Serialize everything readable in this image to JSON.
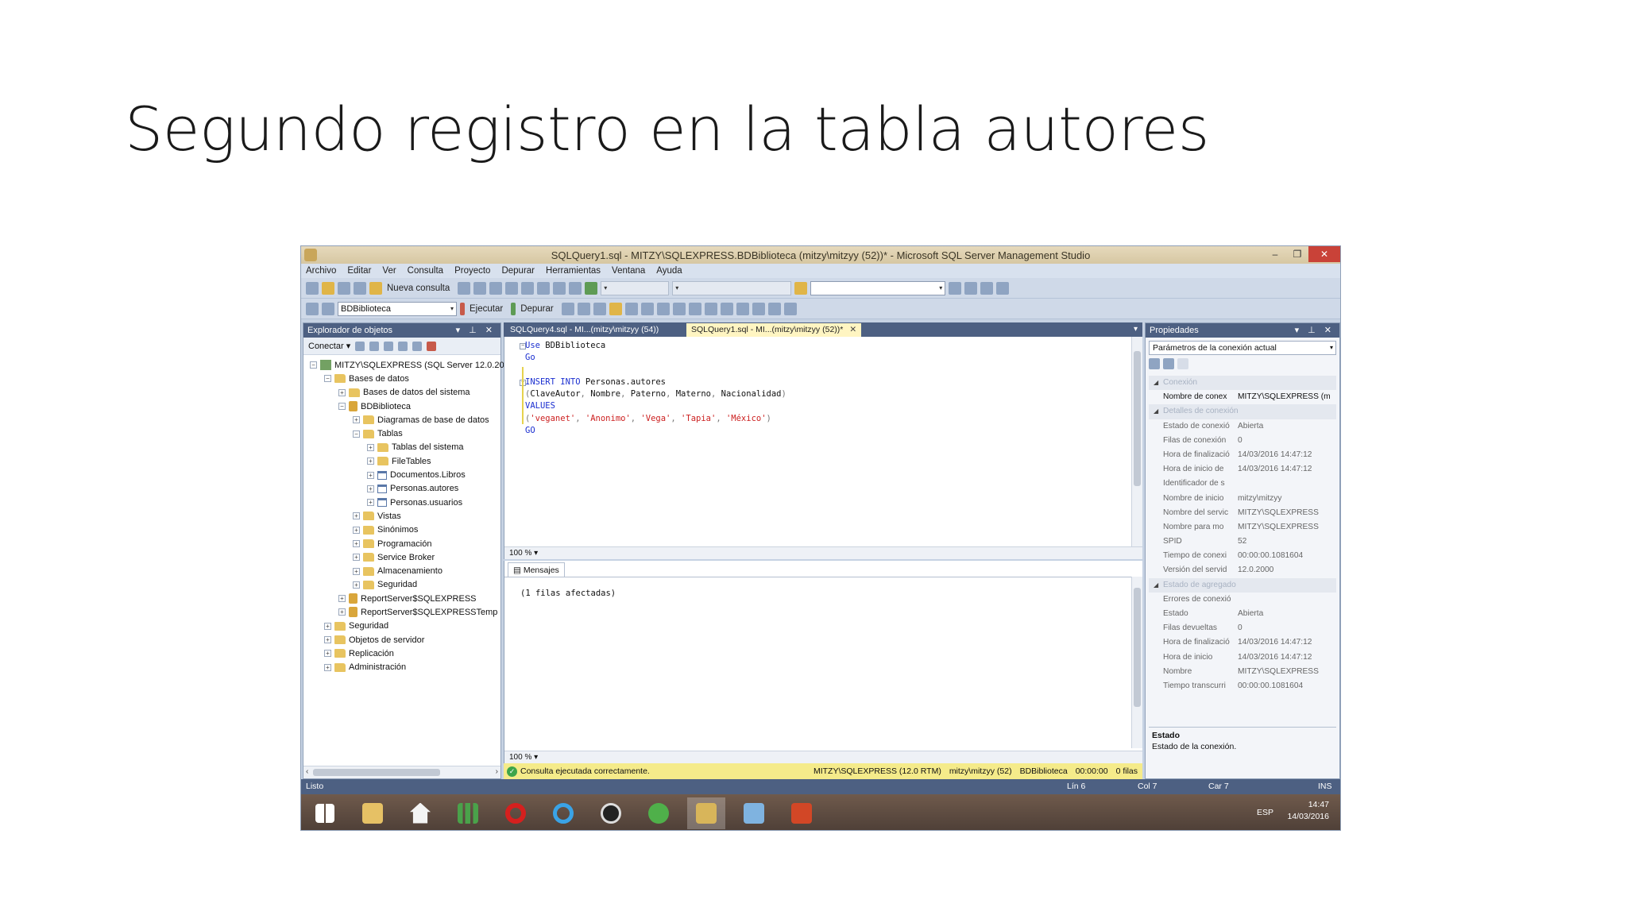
{
  "slide": {
    "title": "Segundo registro en la tabla autores"
  },
  "window": {
    "title": "SQLQuery1.sql - MITZY\\SQLEXPRESS.BDBiblioteca (mitzy\\mitzyy (52))* - Microsoft SQL Server Management Studio",
    "minimize": "–",
    "restore": "❐",
    "close": "✕"
  },
  "menu": [
    "Archivo",
    "Editar",
    "Ver",
    "Consulta",
    "Proyecto",
    "Depurar",
    "Herramientas",
    "Ventana",
    "Ayuda"
  ],
  "toolbar": {
    "new_query": "Nueva consulta",
    "database": "BDBiblioteca",
    "execute": "Ejecutar",
    "debug": "Depurar"
  },
  "explorer": {
    "title": "Explorador de objetos",
    "connect": "Conectar ▾",
    "tree": [
      {
        "indent": 0,
        "toggle": "−",
        "icon": "srv",
        "label": "MITZY\\SQLEXPRESS (SQL Server 12.0.20"
      },
      {
        "indent": 1,
        "toggle": "−",
        "icon": "fo",
        "label": "Bases de datos"
      },
      {
        "indent": 2,
        "toggle": "+",
        "icon": "fo",
        "label": "Bases de datos del sistema"
      },
      {
        "indent": 2,
        "toggle": "−",
        "icon": "db",
        "label": "BDBiblioteca"
      },
      {
        "indent": 3,
        "toggle": "+",
        "icon": "fo",
        "label": "Diagramas de base de datos"
      },
      {
        "indent": 3,
        "toggle": "−",
        "icon": "fo",
        "label": "Tablas"
      },
      {
        "indent": 4,
        "toggle": "+",
        "icon": "fo",
        "label": "Tablas del sistema"
      },
      {
        "indent": 4,
        "toggle": "+",
        "icon": "fo",
        "label": "FileTables"
      },
      {
        "indent": 4,
        "toggle": "+",
        "icon": "tbl",
        "label": "Documentos.Libros"
      },
      {
        "indent": 4,
        "toggle": "+",
        "icon": "tbl",
        "label": "Personas.autores"
      },
      {
        "indent": 4,
        "toggle": "+",
        "icon": "tbl",
        "label": "Personas.usuarios"
      },
      {
        "indent": 3,
        "toggle": "+",
        "icon": "fo",
        "label": "Vistas"
      },
      {
        "indent": 3,
        "toggle": "+",
        "icon": "fo",
        "label": "Sinónimos"
      },
      {
        "indent": 3,
        "toggle": "+",
        "icon": "fo",
        "label": "Programación"
      },
      {
        "indent": 3,
        "toggle": "+",
        "icon": "fo",
        "label": "Service Broker"
      },
      {
        "indent": 3,
        "toggle": "+",
        "icon": "fo",
        "label": "Almacenamiento"
      },
      {
        "indent": 3,
        "toggle": "+",
        "icon": "fo",
        "label": "Seguridad"
      },
      {
        "indent": 2,
        "toggle": "+",
        "icon": "db",
        "label": "ReportServer$SQLEXPRESS"
      },
      {
        "indent": 2,
        "toggle": "+",
        "icon": "db",
        "label": "ReportServer$SQLEXPRESSTemp"
      },
      {
        "indent": 1,
        "toggle": "+",
        "icon": "fo",
        "label": "Seguridad"
      },
      {
        "indent": 1,
        "toggle": "+",
        "icon": "fo",
        "label": "Objetos de servidor"
      },
      {
        "indent": 1,
        "toggle": "+",
        "icon": "fo",
        "label": "Replicación"
      },
      {
        "indent": 1,
        "toggle": "+",
        "icon": "fo",
        "label": "Administración"
      }
    ]
  },
  "tabs": [
    {
      "label": "SQLQuery4.sql - MI...(mitzy\\mitzyy (54))",
      "active": false
    },
    {
      "label": "SQLQuery1.sql - MI...(mitzy\\mitzyy (52))*",
      "active": true
    }
  ],
  "editor": {
    "zoom": "100 %",
    "lines": [
      [
        {
          "t": "Use ",
          "c": "kw"
        },
        {
          "t": "BDBiblioteca",
          "c": "pl"
        }
      ],
      [
        {
          "t": "Go",
          "c": "kw"
        }
      ],
      [],
      [
        {
          "t": "INSERT INTO ",
          "c": "kw"
        },
        {
          "t": "Personas.autores",
          "c": "pl"
        }
      ],
      [
        {
          "t": "(",
          "c": "gy"
        },
        {
          "t": "ClaveAutor",
          "c": "pl"
        },
        {
          "t": ", ",
          "c": "gy"
        },
        {
          "t": "Nombre",
          "c": "pl"
        },
        {
          "t": ", ",
          "c": "gy"
        },
        {
          "t": "Paterno",
          "c": "pl"
        },
        {
          "t": ", ",
          "c": "gy"
        },
        {
          "t": "Materno",
          "c": "pl"
        },
        {
          "t": ", ",
          "c": "gy"
        },
        {
          "t": "Nacionalidad",
          "c": "pl"
        },
        {
          "t": ")",
          "c": "gy"
        }
      ],
      [
        {
          "t": "VALUES",
          "c": "kw"
        }
      ],
      [
        {
          "t": "(",
          "c": "gy"
        },
        {
          "t": "'veganet'",
          "c": "str"
        },
        {
          "t": ", ",
          "c": "gy"
        },
        {
          "t": "'Anonimo'",
          "c": "str"
        },
        {
          "t": ", ",
          "c": "gy"
        },
        {
          "t": "'Vega'",
          "c": "str"
        },
        {
          "t": ", ",
          "c": "gy"
        },
        {
          "t": "'Tapia'",
          "c": "str"
        },
        {
          "t": ", ",
          "c": "gy"
        },
        {
          "t": "'México'",
          "c": "str"
        },
        {
          "t": ")",
          "c": "gy"
        }
      ],
      [
        {
          "t": "GO",
          "c": "kw"
        }
      ]
    ]
  },
  "results": {
    "tab": "Mensajes",
    "message": "(1 filas afectadas)",
    "zoom": "100 %"
  },
  "query_status": {
    "text": "Consulta ejecutada correctamente.",
    "server": "MITZY\\SQLEXPRESS (12.0 RTM)",
    "user": "mitzy\\mitzyy (52)",
    "db": "BDBiblioteca",
    "time": "00:00:00",
    "rows": "0 filas"
  },
  "properties": {
    "title": "Propiedades",
    "combo": "Parámetros de la conexión actual",
    "rows": [
      {
        "type": "cat",
        "k": "Conexión"
      },
      {
        "type": "hi",
        "k": "Nombre de conex",
        "v": "MITZY\\SQLEXPRESS (m"
      },
      {
        "type": "cat",
        "k": "Detalles de conexión"
      },
      {
        "k": "Estado de conexió",
        "v": "Abierta"
      },
      {
        "k": "Filas de conexión",
        "v": "0"
      },
      {
        "k": "Hora de finalizació",
        "v": "14/03/2016 14:47:12"
      },
      {
        "k": "Hora de inicio de",
        "v": "14/03/2016 14:47:12"
      },
      {
        "k": "Identificador de s",
        "v": ""
      },
      {
        "k": "Nombre de inicio",
        "v": "mitzy\\mitzyy"
      },
      {
        "k": "Nombre del servic",
        "v": "MITZY\\SQLEXPRESS"
      },
      {
        "k": "Nombre para mo",
        "v": "MITZY\\SQLEXPRESS"
      },
      {
        "k": "SPID",
        "v": "52"
      },
      {
        "k": "Tiempo de conexi",
        "v": "00:00:00.1081604"
      },
      {
        "k": "Versión del servid",
        "v": "12.0.2000"
      },
      {
        "type": "cat",
        "k": "Estado de agregado"
      },
      {
        "k": "Errores de conexió",
        "v": ""
      },
      {
        "k": "Estado",
        "v": "Abierta"
      },
      {
        "k": "Filas devueltas",
        "v": "0"
      },
      {
        "k": "Hora de finalizació",
        "v": "14/03/2016 14:47:12"
      },
      {
        "k": "Hora de inicio",
        "v": "14/03/2016 14:47:12"
      },
      {
        "k": "Nombre",
        "v": "MITZY\\SQLEXPRESS"
      },
      {
        "k": "Tiempo transcurri",
        "v": "00:00:00.1081604"
      }
    ],
    "desc_title": "Estado",
    "desc_text": "Estado de la conexión."
  },
  "statusbar": {
    "ready": "Listo",
    "ln": "Lín 6",
    "col": "Col 7",
    "car": "Car 7",
    "ins": "INS"
  },
  "taskbar": {
    "lang": "ESP",
    "time": "14:47",
    "date": "14/03/2016",
    "apps": [
      "start",
      "explorer",
      "home",
      "chart",
      "opera",
      "ie",
      "media",
      "cloud",
      "ssms",
      "notes",
      "powerpoint"
    ]
  },
  "colors": {
    "chrome": "#4d6082",
    "tab_active": "#fff5c2",
    "status_ok": "#f5eb8a"
  }
}
